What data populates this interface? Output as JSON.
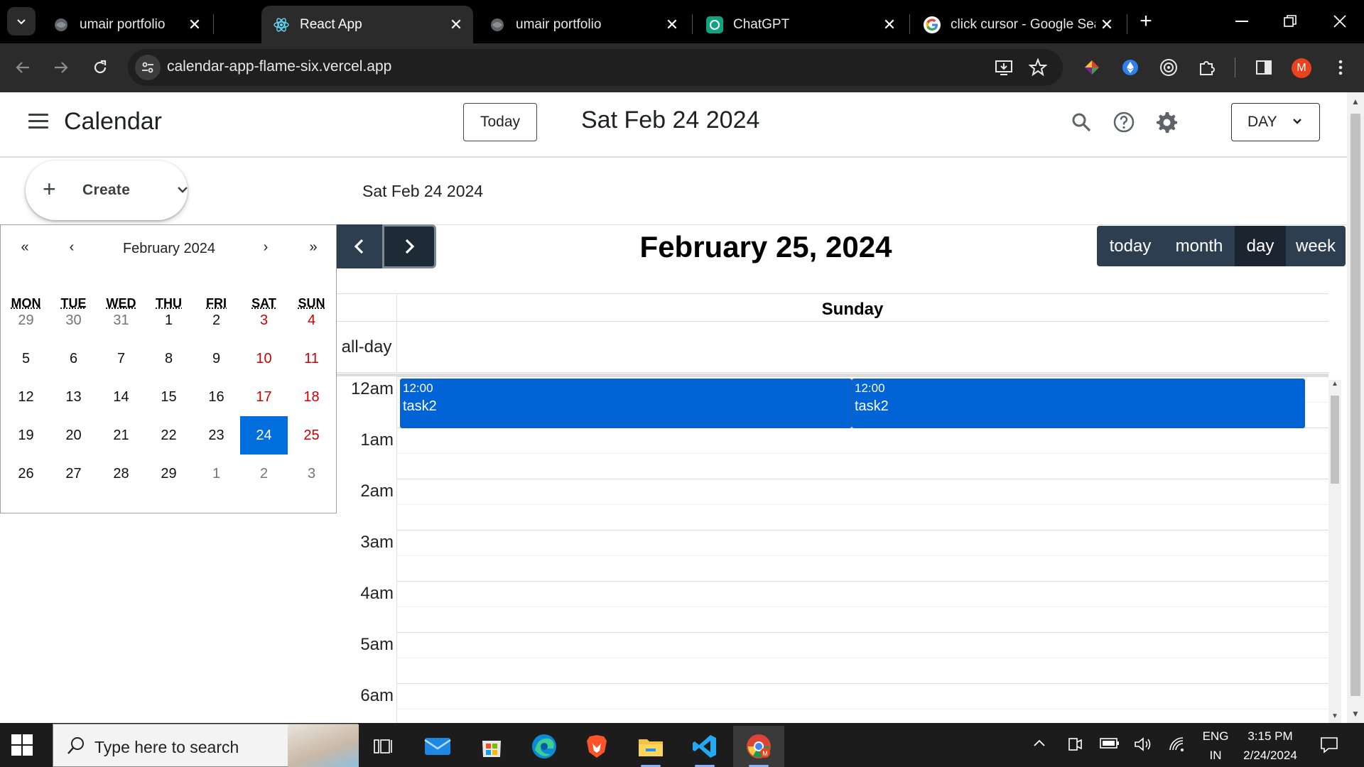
{
  "browser": {
    "tabs": [
      {
        "title": "umair portfolio",
        "active": false
      },
      {
        "title": "React App",
        "active": true
      },
      {
        "title": "umair portfolio",
        "active": false
      },
      {
        "title": "ChatGPT",
        "active": false
      },
      {
        "title": "click cursor - Google Sea",
        "active": false
      }
    ],
    "url": "calendar-app-flame-six.vercel.app",
    "profile_initial": "M"
  },
  "app": {
    "title": "Calendar",
    "today_label": "Today",
    "header_date": "Sat Feb 24 2024",
    "view_label": "DAY",
    "create_label": "Create",
    "sub_date": "Sat Feb 24 2024"
  },
  "mini_calendar": {
    "nav": {
      "prev_year": "«",
      "prev_month": "‹",
      "next_month": "›",
      "next_year": "»"
    },
    "month_label": "February 2024",
    "weekdays": [
      "MON",
      "TUE",
      "WED",
      "THU",
      "FRI",
      "SAT",
      "SUN"
    ],
    "weeks": [
      [
        "29",
        "30",
        "31",
        "1",
        "2",
        "3",
        "4"
      ],
      [
        "5",
        "6",
        "7",
        "8",
        "9",
        "10",
        "11"
      ],
      [
        "12",
        "13",
        "14",
        "15",
        "16",
        "17",
        "18"
      ],
      [
        "19",
        "20",
        "21",
        "22",
        "23",
        "24",
        "25"
      ],
      [
        "26",
        "27",
        "28",
        "29",
        "1",
        "2",
        "3"
      ]
    ],
    "selected": "24"
  },
  "fullcalendar": {
    "title": "February 25, 2024",
    "views": [
      "today",
      "month",
      "day",
      "week"
    ],
    "active_view": "day",
    "day_header": "Sunday",
    "allday_label": "all-day",
    "hours": [
      "12am",
      "1am",
      "2am",
      "3am",
      "4am",
      "5am",
      "6am"
    ],
    "events": [
      {
        "time": "12:00",
        "title": "task2"
      },
      {
        "time": "12:00",
        "title": "task2"
      }
    ]
  },
  "taskbar": {
    "search_placeholder": "Type here to search",
    "language": "ENG",
    "region": "IN",
    "time": "3:15 PM",
    "date": "2/24/2024"
  },
  "colors": {
    "accent_blue": "#0064d7",
    "fc_button": "#2c3e50",
    "weekend_red": "#d10000",
    "selected_day": "#006edc"
  }
}
